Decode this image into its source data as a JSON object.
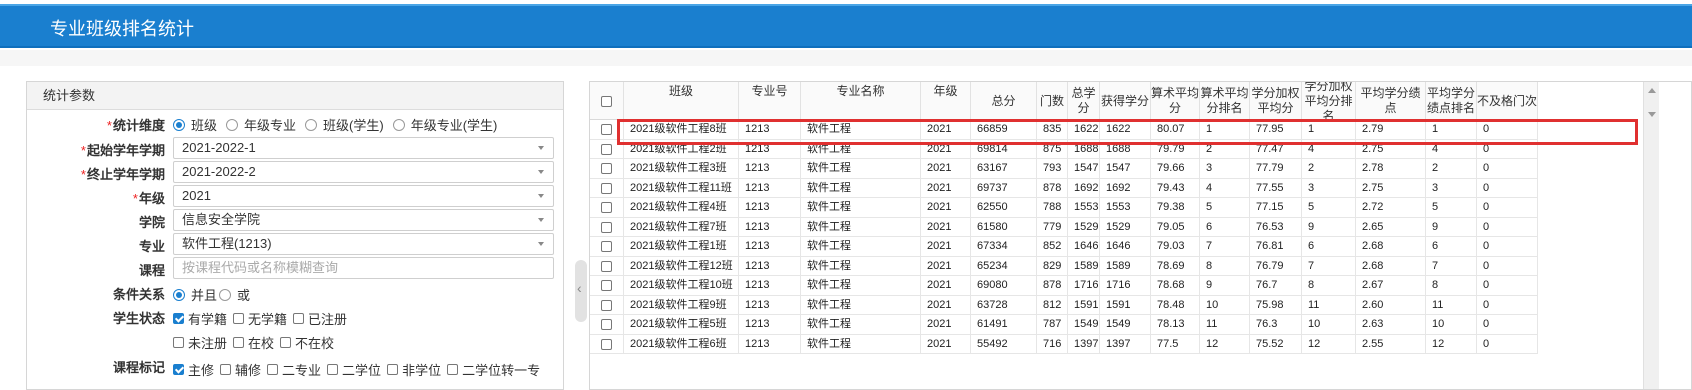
{
  "header": {
    "title": "专业班级排名统计"
  },
  "panel": {
    "title": "统计参数",
    "dimension": {
      "label": "统计维度",
      "required": true,
      "options": [
        "班级",
        "年级专业",
        "班级(学生)",
        "年级专业(学生)"
      ],
      "selected": 0
    },
    "start_term": {
      "label": "起始学年学期",
      "required": true,
      "value": "2021-2022-1"
    },
    "end_term": {
      "label": "终止学年学期",
      "required": true,
      "value": "2021-2022-2"
    },
    "grade": {
      "label": "年级",
      "required": true,
      "value": "2021"
    },
    "college": {
      "label": "学院",
      "required": false,
      "value": "信息安全学院"
    },
    "major": {
      "label": "专业",
      "required": false,
      "value": "软件工程(1213)"
    },
    "course": {
      "label": "课程",
      "required": false,
      "placeholder": "按课程代码或名称模糊查询"
    },
    "condition": {
      "label": "条件关系",
      "options": [
        "并且",
        "或"
      ],
      "selected": 0
    },
    "student_status": {
      "label": "学生状态",
      "options": [
        {
          "text": "有学籍",
          "checked": true
        },
        {
          "text": "无学籍",
          "checked": false
        },
        {
          "text": "已注册",
          "checked": false
        },
        {
          "text": "未注册",
          "checked": false
        },
        {
          "text": "在校",
          "checked": false
        },
        {
          "text": "不在校",
          "checked": false
        }
      ]
    },
    "course_flag": {
      "label": "课程标记",
      "options": [
        {
          "text": "主修",
          "checked": true
        },
        {
          "text": "辅修",
          "checked": false
        },
        {
          "text": "二专业",
          "checked": false
        },
        {
          "text": "二学位",
          "checked": false
        },
        {
          "text": "非学位",
          "checked": false
        },
        {
          "text": "二学位转一专",
          "checked": false
        }
      ]
    }
  },
  "grid": {
    "columns": [
      "",
      "班级",
      "专业号",
      "专业名称",
      "年级",
      "总分",
      "门数",
      "总学分",
      "获得学分",
      "算术平均分",
      "算术平均分排名",
      "学分加权平均分",
      "学分加权平均分排名",
      "平均学分绩点",
      "平均学分绩点排名",
      "不及格门次"
    ],
    "rows": [
      [
        "2021级软件工程8班",
        "1213",
        "软件工程",
        "2021",
        "66859",
        "835",
        "1622",
        "1622",
        "80.07",
        "1",
        "77.95",
        "1",
        "2.79",
        "1",
        "0"
      ],
      [
        "2021级软件工程2班",
        "1213",
        "软件工程",
        "2021",
        "69814",
        "875",
        "1688",
        "1688",
        "79.79",
        "2",
        "77.47",
        "4",
        "2.75",
        "4",
        "0"
      ],
      [
        "2021级软件工程3班",
        "1213",
        "软件工程",
        "2021",
        "63167",
        "793",
        "1547",
        "1547",
        "79.66",
        "3",
        "77.79",
        "2",
        "2.78",
        "2",
        "0"
      ],
      [
        "2021级软件工程11班",
        "1213",
        "软件工程",
        "2021",
        "69737",
        "878",
        "1692",
        "1692",
        "79.43",
        "4",
        "77.55",
        "3",
        "2.75",
        "3",
        "0"
      ],
      [
        "2021级软件工程4班",
        "1213",
        "软件工程",
        "2021",
        "62550",
        "788",
        "1553",
        "1553",
        "79.38",
        "5",
        "77.15",
        "5",
        "2.72",
        "5",
        "0"
      ],
      [
        "2021级软件工程7班",
        "1213",
        "软件工程",
        "2021",
        "61580",
        "779",
        "1529",
        "1529",
        "79.05",
        "6",
        "76.53",
        "9",
        "2.65",
        "9",
        "0"
      ],
      [
        "2021级软件工程1班",
        "1213",
        "软件工程",
        "2021",
        "67334",
        "852",
        "1646",
        "1646",
        "79.03",
        "7",
        "76.81",
        "6",
        "2.68",
        "6",
        "0"
      ],
      [
        "2021级软件工程12班",
        "1213",
        "软件工程",
        "2021",
        "65234",
        "829",
        "1589",
        "1589",
        "78.69",
        "8",
        "76.79",
        "7",
        "2.68",
        "7",
        "0"
      ],
      [
        "2021级软件工程10班",
        "1213",
        "软件工程",
        "2021",
        "69080",
        "878",
        "1716",
        "1716",
        "78.68",
        "9",
        "76.7",
        "8",
        "2.67",
        "8",
        "0"
      ],
      [
        "2021级软件工程9班",
        "1213",
        "软件工程",
        "2021",
        "63728",
        "812",
        "1591",
        "1591",
        "78.48",
        "10",
        "75.98",
        "11",
        "2.60",
        "11",
        "0"
      ],
      [
        "2021级软件工程5班",
        "1213",
        "软件工程",
        "2021",
        "61491",
        "787",
        "1549",
        "1549",
        "78.13",
        "11",
        "76.3",
        "10",
        "2.63",
        "10",
        "0"
      ],
      [
        "2021级软件工程6班",
        "1213",
        "软件工程",
        "2021",
        "55492",
        "716",
        "1397",
        "1397",
        "77.5",
        "12",
        "75.52",
        "12",
        "2.55",
        "12",
        "0"
      ]
    ]
  },
  "accent_color": "#1a7fcf",
  "highlight_color": "#e03030"
}
